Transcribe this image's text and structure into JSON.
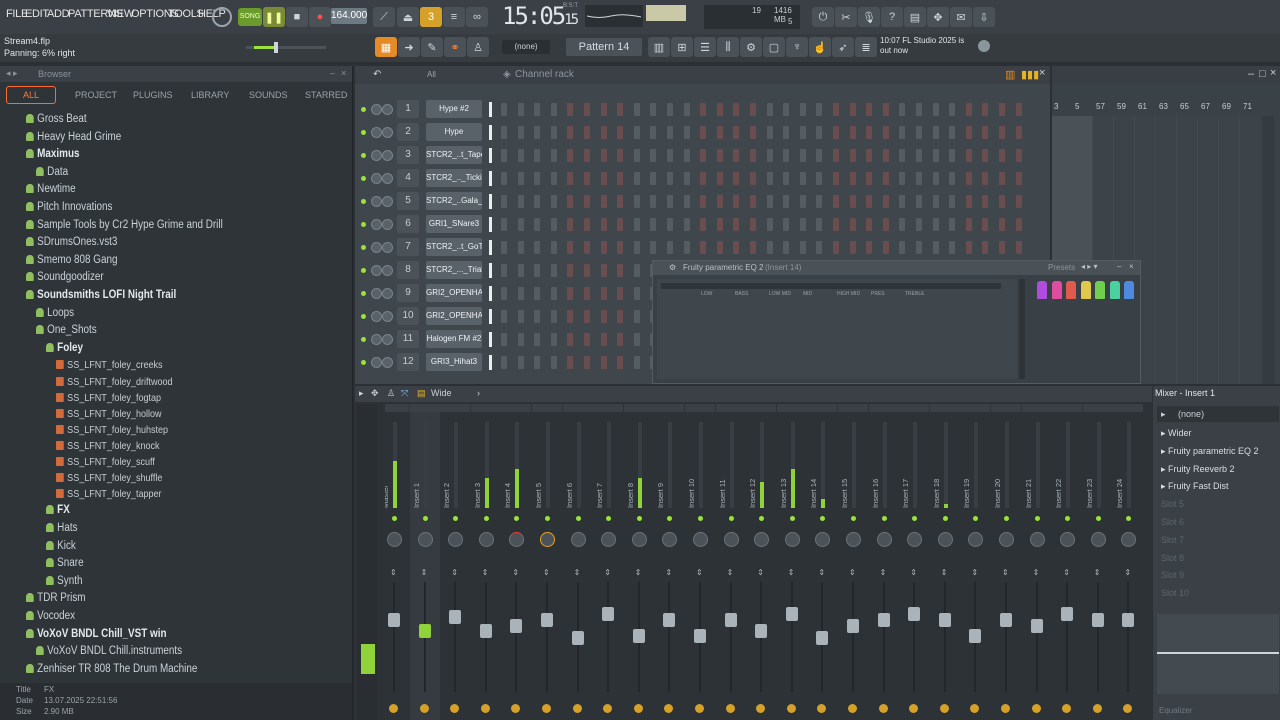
{
  "menu": [
    "FILE",
    "EDIT",
    "ADD",
    "PATTERNS",
    "VIEW",
    "OPTIONS",
    "TOOLS",
    "HELP"
  ],
  "transport": {
    "mode": "SONG",
    "tempo": "164.000",
    "time": "15:05",
    "time_sub": "15",
    "time_tag": "B:S:T"
  },
  "cpu": {
    "value": "19",
    "memory": "1416 MB",
    "voices": "5"
  },
  "project": {
    "file": "Stream4.flp",
    "hint": "Panning: 6% right"
  },
  "toolbar2": {
    "pattern_select": "(none)",
    "pattern_name": "Pattern 14",
    "news": "10:07 FL Studio 2025 is out now"
  },
  "browser": {
    "title": "Browser",
    "tabs": [
      "ALL",
      "PROJECT",
      "PLUGINS",
      "LIBRARY",
      "SOUNDS",
      "STARRED"
    ],
    "items": [
      {
        "label": "Gross Beat",
        "kind": "folder",
        "depth": 0
      },
      {
        "label": "Heavy Head Grime",
        "kind": "folder",
        "depth": 0
      },
      {
        "label": "Maximus",
        "kind": "folder-bold",
        "depth": 0
      },
      {
        "label": "Data",
        "kind": "folder",
        "depth": 1
      },
      {
        "label": "Newtime",
        "kind": "folder",
        "depth": 0
      },
      {
        "label": "Pitch Innovations",
        "kind": "folder",
        "depth": 0
      },
      {
        "label": "Sample Tools by Cr2 Hype Grime and Drill",
        "kind": "folder",
        "depth": 0
      },
      {
        "label": "SDrumsOnes.vst3",
        "kind": "folder",
        "depth": 0
      },
      {
        "label": "Smemo 808 Gang",
        "kind": "folder",
        "depth": 0
      },
      {
        "label": "Soundgoodizer",
        "kind": "folder",
        "depth": 0
      },
      {
        "label": "Soundsmiths LOFI Night Trail",
        "kind": "folder-bold",
        "depth": 0
      },
      {
        "label": "Loops",
        "kind": "folder",
        "depth": 1
      },
      {
        "label": "One_Shots",
        "kind": "folder",
        "depth": 1
      },
      {
        "label": "Foley",
        "kind": "folder-bold",
        "depth": 2
      },
      {
        "label": "SS_LFNT_foley_creeks",
        "kind": "file",
        "depth": 3
      },
      {
        "label": "SS_LFNT_foley_driftwood",
        "kind": "file",
        "depth": 3
      },
      {
        "label": "SS_LFNT_foley_fogtap",
        "kind": "file",
        "depth": 3
      },
      {
        "label": "SS_LFNT_foley_hollow",
        "kind": "file",
        "depth": 3
      },
      {
        "label": "SS_LFNT_foley_huhstep",
        "kind": "file",
        "depth": 3
      },
      {
        "label": "SS_LFNT_foley_knock",
        "kind": "file",
        "depth": 3
      },
      {
        "label": "SS_LFNT_foley_scuff",
        "kind": "file",
        "depth": 3
      },
      {
        "label": "SS_LFNT_foley_shuffle",
        "kind": "file",
        "depth": 3
      },
      {
        "label": "SS_LFNT_foley_tapper",
        "kind": "file",
        "depth": 3
      },
      {
        "label": "FX",
        "kind": "folder-bold",
        "depth": 2
      },
      {
        "label": "Hats",
        "kind": "folder",
        "depth": 2
      },
      {
        "label": "Kick",
        "kind": "folder",
        "depth": 2
      },
      {
        "label": "Snare",
        "kind": "folder",
        "depth": 2
      },
      {
        "label": "Synth",
        "kind": "folder",
        "depth": 2
      },
      {
        "label": "TDR Prism",
        "kind": "folder",
        "depth": 0
      },
      {
        "label": "Vocodex",
        "kind": "folder",
        "depth": 0
      },
      {
        "label": "VoXoV BNDL Chill_VST win",
        "kind": "folder-bold",
        "depth": 0
      },
      {
        "label": "VoXoV BNDL Chill.instruments",
        "kind": "folder",
        "depth": 1
      },
      {
        "label": "Zenhiser TR 808 The Drum Machine",
        "kind": "folder",
        "depth": 0
      }
    ],
    "footer": {
      "title_label": "Title",
      "title": "FX",
      "date_label": "Date",
      "date": "13.07.2025 22:51:56",
      "size_label": "Size",
      "size": "2.90 MB"
    }
  },
  "channel_rack": {
    "filter": "All",
    "title": "Channel rack",
    "channels": [
      {
        "num": "1",
        "name": "Hype #2"
      },
      {
        "num": "2",
        "name": "Hype"
      },
      {
        "num": "3",
        "name": "STCR2_..t_Tape"
      },
      {
        "num": "4",
        "name": "STCR2_.._Tickin"
      },
      {
        "num": "5",
        "name": "STCR2_..Gala_C"
      },
      {
        "num": "6",
        "name": "GRI1_SNare3"
      },
      {
        "num": "7",
        "name": "STCR2_..t_GoTo"
      },
      {
        "num": "8",
        "name": "STCR2_..._Trials"
      },
      {
        "num": "9",
        "name": "GRI2_OPENHAT2"
      },
      {
        "num": "10",
        "name": "GRI2_OPENHAT3"
      },
      {
        "num": "11",
        "name": "Halogen FM #2"
      },
      {
        "num": "12",
        "name": "GRI3_Hihat3"
      }
    ]
  },
  "playlist": {
    "ruler": [
      "3",
      "5",
      "57",
      "59",
      "61",
      "63",
      "65",
      "67",
      "69",
      "71"
    ]
  },
  "eq": {
    "title": "Fruity parametric EQ 2",
    "subtitle": "(Insert 14)",
    "presets": "Presets",
    "bands": [
      "LOW",
      "BASS",
      "LOW MID",
      "MID",
      "HIGH MID",
      "PRES",
      "TREBLE"
    ]
  },
  "mixer": {
    "view": "Wide",
    "strips": [
      "Master",
      "Insert 1",
      "Insert 2",
      "Insert 3",
      "Insert 4",
      "Insert 5",
      "Insert 6",
      "Insert 7",
      "Insert 8",
      "Insert 9",
      "Insert 10",
      "Insert 11",
      "Insert 12",
      "Insert 13",
      "Insert 14",
      "Insert 15",
      "Insert 16",
      "Insert 17",
      "Insert 18",
      "Insert 19",
      "Insert 20",
      "Insert 21",
      "Insert 22",
      "Insert 23",
      "Insert 24"
    ],
    "fader_levels": [
      0.72,
      0.62,
      0.75,
      0.62,
      0.66,
      0.72,
      0.55,
      0.77,
      0.57,
      0.72,
      0.57,
      0.72,
      0.62,
      0.77,
      0.55,
      0.66,
      0.72,
      0.77,
      0.72,
      0.57,
      0.72,
      0.66,
      0.77,
      0.72,
      0.72
    ]
  },
  "insert_panel": {
    "title": "Mixer - Insert 1",
    "input": "(none)",
    "slots": [
      "Wider",
      "Fruity parametric EQ 2",
      "Fruity Reeverb 2",
      "Fruity Fast Dist",
      "Slot 5",
      "Slot 6",
      "Slot 7",
      "Slot 8",
      "Slot 9",
      "Slot 10"
    ],
    "footer": "Equalizer"
  },
  "colors": {
    "accent": "#ff6a2a",
    "green": "#9be23a",
    "meter": "#8fd23a"
  }
}
